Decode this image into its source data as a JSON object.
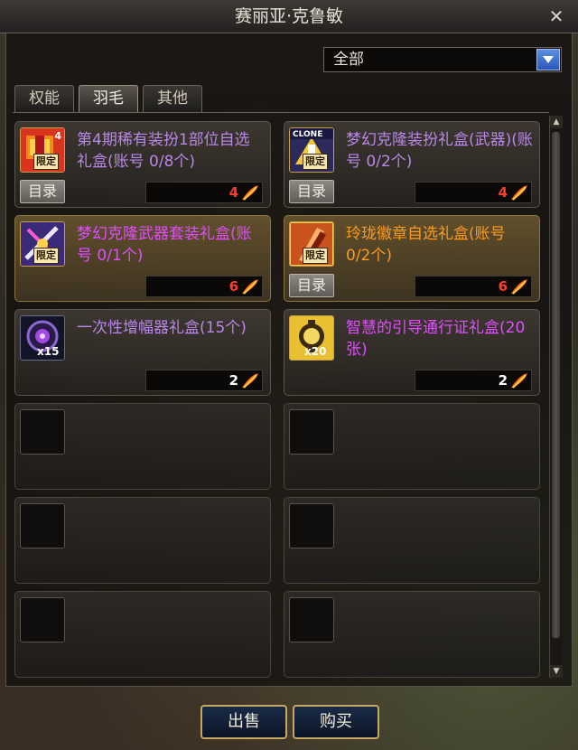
{
  "window": {
    "title": "赛丽亚·克鲁敏",
    "close_symbol": "✕"
  },
  "filter": {
    "selected": "全部"
  },
  "tabs": [
    {
      "label": "权能",
      "active": false
    },
    {
      "label": "羽毛",
      "active": true
    },
    {
      "label": "其他",
      "active": false
    }
  ],
  "items": [
    {
      "name": "第4期稀有装扮1部位自选礼盒(账号 0/8个)",
      "name_color": "purple",
      "icon": "limited-costume-box-icon",
      "icon_tag": "限定",
      "icon_num": "4",
      "catalog_label": "目录",
      "price": "4",
      "price_color": "red"
    },
    {
      "name": "梦幻克隆装扮礼盒(武器)(账号 0/2个)",
      "name_color": "purple",
      "icon": "clone-costume-box-icon",
      "icon_tag": "限定",
      "icon_num": "CLONE",
      "catalog_label": "目录",
      "price": "4",
      "price_color": "red"
    },
    {
      "name": "梦幻克隆武器套装礼盒(账号 0/1个)",
      "name_color": "magenta",
      "icon": "clone-weapon-box-icon",
      "icon_tag": "限定",
      "icon_num": "",
      "catalog_label": "",
      "price": "6",
      "price_color": "red"
    },
    {
      "name": "玲珑徽章自选礼盒(账号 0/2个)",
      "name_color": "orange",
      "icon": "emblem-box-icon",
      "icon_tag": "限定",
      "icon_num": "",
      "catalog_label": "目录",
      "price": "6",
      "price_color": "red"
    },
    {
      "name": "一次性增幅器礼盒(15个)",
      "name_color": "purple",
      "icon": "amplifier-orb-icon",
      "icon_tag": "",
      "icon_num": "x15",
      "catalog_label": "",
      "price": "2",
      "price_color": "white"
    },
    {
      "name": "智慧的引导通行证礼盒(20张)",
      "name_color": "magenta",
      "icon": "guidance-pass-icon",
      "icon_tag": "",
      "icon_num": "x20",
      "catalog_label": "",
      "price": "2",
      "price_color": "white"
    }
  ],
  "empty_slots": 6,
  "actions": {
    "sell_label": "出售",
    "buy_label": "购买"
  },
  "colors": {
    "purple": "#b987ea",
    "magenta": "#e14dff",
    "orange": "#ff9a1f",
    "price_red": "#ff3b2b",
    "accent_blue": "#3a6fd0",
    "border_gold": "#c6a862"
  }
}
